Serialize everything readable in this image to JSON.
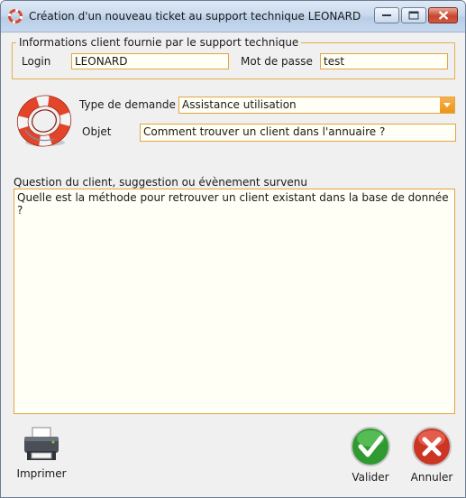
{
  "window": {
    "title": "Création d'un nouveau ticket au support technique LEONARD",
    "controls": [
      "minimize-icon",
      "maximize-icon",
      "close-icon"
    ]
  },
  "client_info": {
    "legend": "Informations client fournie par le support technique",
    "login_label": "Login",
    "login_value": "LEONARD",
    "password_label": "Mot de passe",
    "password_value": "test"
  },
  "request": {
    "type_label": "Type de demande",
    "type_value": "Assistance utilisation",
    "subject_label": "Objet",
    "subject_value": "Comment trouver un client dans l'annuaire ?"
  },
  "question": {
    "label": "Question du client, suggestion ou évènement survenu",
    "value": "Quelle est la méthode pour retrouver un client existant dans la base de donnée ?"
  },
  "actions": {
    "print_label": "Imprimer",
    "validate_label": "Valider",
    "cancel_label": "Annuler"
  },
  "colors": {
    "field_border": "#e3a544",
    "field_background": "#fffff5",
    "validate": "#3aa53a",
    "cancel": "#d23a2a"
  }
}
